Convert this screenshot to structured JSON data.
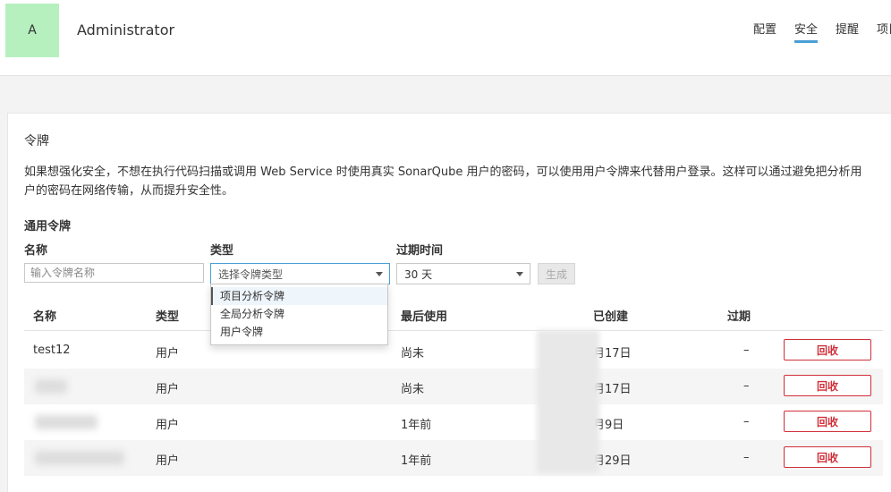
{
  "header": {
    "avatar_letter": "A",
    "username": "Administrator",
    "tabs": [
      "配置",
      "安全",
      "提醒",
      "项目"
    ],
    "active_tab": "安全"
  },
  "tokens": {
    "title": "令牌",
    "description": "如果想强化安全，不想在执行代码扫描或调用 Web Service 时使用真实 SonarQube 用户的密码，可以使用用户令牌来代替用户登录。这样可以通过避免把分析用户的密码在网络传输，从而提升安全性。",
    "subtitle": "通用令牌",
    "form": {
      "name_label": "名称",
      "name_placeholder": "输入令牌名称",
      "type_label": "类型",
      "type_placeholder": "选择令牌类型",
      "expire_label": "过期时间",
      "expire_value": "30 天",
      "generate_label": "生成"
    },
    "type_options": [
      "项目分析令牌",
      "全局分析令牌",
      "用户令牌"
    ],
    "table": {
      "headers": [
        "名称",
        "类型",
        "最后使用",
        "已创建",
        "过期"
      ],
      "rows": [
        {
          "name": "test12",
          "type": "用户",
          "last_used": "尚未",
          "created": "月17日",
          "expires": "–",
          "action": "回收"
        },
        {
          "name": "",
          "type": "用户",
          "last_used": "尚未",
          "created": "月17日",
          "expires": "–",
          "action": "回收"
        },
        {
          "name": "",
          "type": "用户",
          "last_used": "1年前",
          "created": "月9日",
          "expires": "–",
          "action": "回收"
        },
        {
          "name": "",
          "type": "用户",
          "last_used": "1年前",
          "created": "月29日",
          "expires": "–",
          "action": "回收"
        }
      ]
    }
  }
}
